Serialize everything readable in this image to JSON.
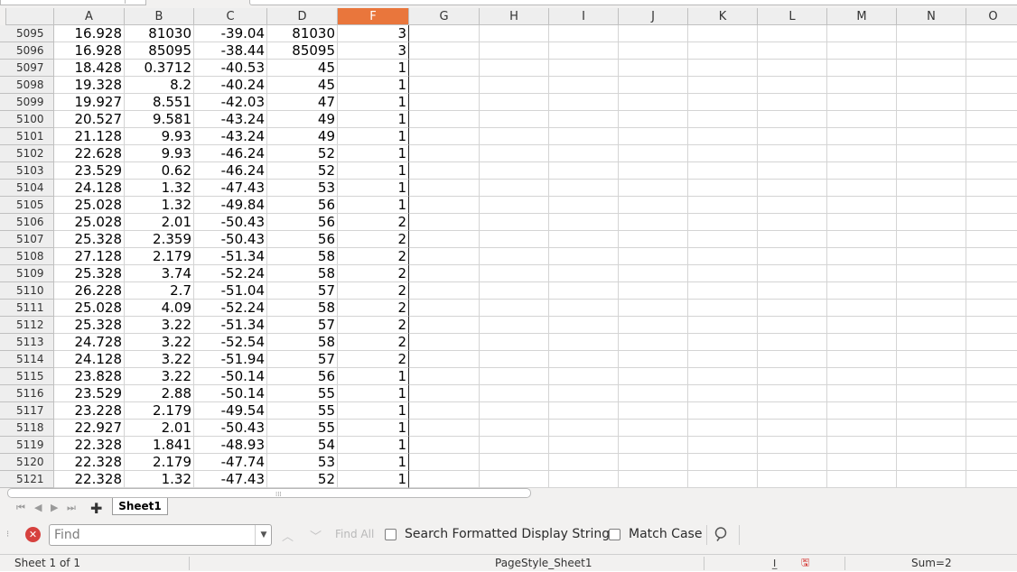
{
  "columns": [
    {
      "label": "A",
      "selected": false
    },
    {
      "label": "B",
      "selected": false
    },
    {
      "label": "C",
      "selected": false
    },
    {
      "label": "D",
      "selected": false
    },
    {
      "label": "F",
      "selected": true
    },
    {
      "label": "G",
      "selected": false
    },
    {
      "label": "H",
      "selected": false
    },
    {
      "label": "I",
      "selected": false
    },
    {
      "label": "J",
      "selected": false
    },
    {
      "label": "K",
      "selected": false
    },
    {
      "label": "L",
      "selected": false
    },
    {
      "label": "M",
      "selected": false
    },
    {
      "label": "N",
      "selected": false
    },
    {
      "label": "O",
      "selected": false
    }
  ],
  "rows": [
    {
      "num": "5095",
      "cells": [
        "16.928",
        "81030",
        "-39.04",
        "81030",
        "3"
      ]
    },
    {
      "num": "5096",
      "cells": [
        "16.928",
        "85095",
        "-38.44",
        "85095",
        "3"
      ]
    },
    {
      "num": "5097",
      "cells": [
        "18.428",
        "0.3712",
        "-40.53",
        "45",
        "1"
      ]
    },
    {
      "num": "5098",
      "cells": [
        "19.328",
        "8.2",
        "-40.24",
        "45",
        "1"
      ]
    },
    {
      "num": "5099",
      "cells": [
        "19.927",
        "8.551",
        "-42.03",
        "47",
        "1"
      ]
    },
    {
      "num": "5100",
      "cells": [
        "20.527",
        "9.581",
        "-43.24",
        "49",
        "1"
      ]
    },
    {
      "num": "5101",
      "cells": [
        "21.128",
        "9.93",
        "-43.24",
        "49",
        "1"
      ]
    },
    {
      "num": "5102",
      "cells": [
        "22.628",
        "9.93",
        "-46.24",
        "52",
        "1"
      ]
    },
    {
      "num": "5103",
      "cells": [
        "23.529",
        "0.62",
        "-46.24",
        "52",
        "1"
      ]
    },
    {
      "num": "5104",
      "cells": [
        "24.128",
        "1.32",
        "-47.43",
        "53",
        "1"
      ]
    },
    {
      "num": "5105",
      "cells": [
        "25.028",
        "1.32",
        "-49.84",
        "56",
        "1"
      ]
    },
    {
      "num": "5106",
      "cells": [
        "25.028",
        "2.01",
        "-50.43",
        "56",
        "2"
      ]
    },
    {
      "num": "5107",
      "cells": [
        "25.328",
        "2.359",
        "-50.43",
        "56",
        "2"
      ]
    },
    {
      "num": "5108",
      "cells": [
        "27.128",
        "2.179",
        "-51.34",
        "58",
        "2"
      ]
    },
    {
      "num": "5109",
      "cells": [
        "25.328",
        "3.74",
        "-52.24",
        "58",
        "2"
      ]
    },
    {
      "num": "5110",
      "cells": [
        "26.228",
        "2.7",
        "-51.04",
        "57",
        "2"
      ]
    },
    {
      "num": "5111",
      "cells": [
        "25.028",
        "4.09",
        "-52.24",
        "58",
        "2"
      ]
    },
    {
      "num": "5112",
      "cells": [
        "25.328",
        "3.22",
        "-51.34",
        "57",
        "2"
      ]
    },
    {
      "num": "5113",
      "cells": [
        "24.728",
        "3.22",
        "-52.54",
        "58",
        "2"
      ]
    },
    {
      "num": "5114",
      "cells": [
        "24.128",
        "3.22",
        "-51.94",
        "57",
        "2"
      ]
    },
    {
      "num": "5115",
      "cells": [
        "23.828",
        "3.22",
        "-50.14",
        "56",
        "1"
      ]
    },
    {
      "num": "5116",
      "cells": [
        "23.529",
        "2.88",
        "-50.14",
        "55",
        "1"
      ]
    },
    {
      "num": "5117",
      "cells": [
        "23.228",
        "2.179",
        "-49.54",
        "55",
        "1"
      ]
    },
    {
      "num": "5118",
      "cells": [
        "22.927",
        "2.01",
        "-50.43",
        "55",
        "1"
      ]
    },
    {
      "num": "5119",
      "cells": [
        "22.328",
        "1.841",
        "-48.93",
        "54",
        "1"
      ]
    },
    {
      "num": "5120",
      "cells": [
        "22.328",
        "2.179",
        "-47.74",
        "53",
        "1"
      ]
    },
    {
      "num": "5121",
      "cells": [
        "22.328",
        "1.32",
        "-47.43",
        "52",
        "1"
      ]
    }
  ],
  "sheet_tab": {
    "label": "Sheet1"
  },
  "find_bar": {
    "placeholder": "Find",
    "find_all_label": "Find All",
    "formatted_label": "Search Formatted Display String",
    "match_case_label": "Match Case"
  },
  "status_bar": {
    "sheet_position": "Sheet 1 of 1",
    "page_style": "PageStyle_Sheet1",
    "sum": "Sum=2"
  },
  "colors": {
    "selected_header": "#e9763c",
    "close_button": "#d6413e",
    "chrome": "#f2f1f0"
  }
}
